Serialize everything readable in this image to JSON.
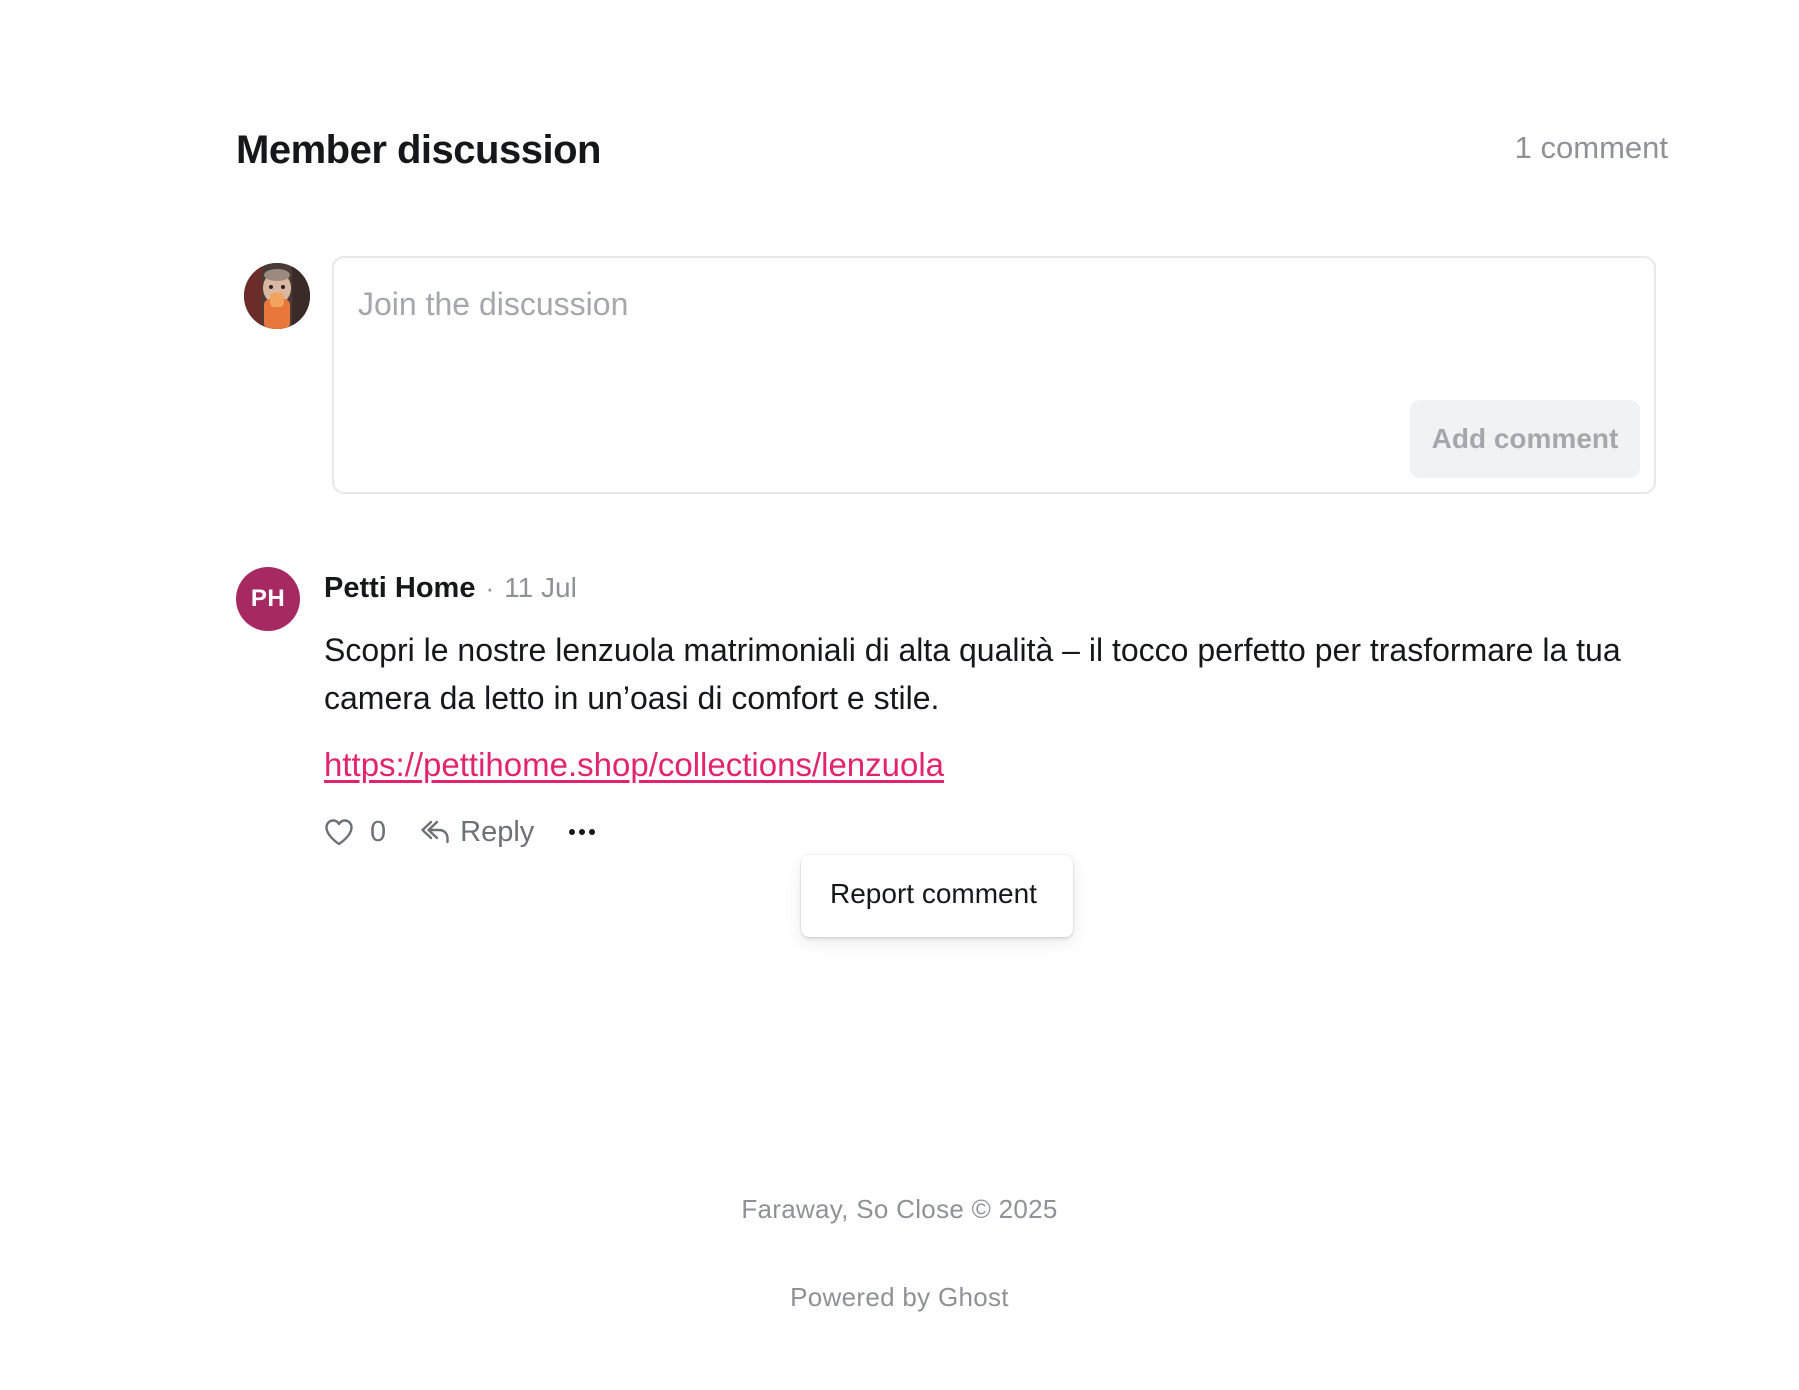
{
  "header": {
    "title": "Member discussion",
    "count": "1 comment"
  },
  "composer": {
    "placeholder": "Join the discussion",
    "submit_label": "Add comment",
    "avatar_icon": "user-photo-avatar"
  },
  "comments": [
    {
      "initials": "PH",
      "avatar_color": "#a62a61",
      "author": "Petti Home",
      "separator": "·",
      "date": "11 Jul",
      "body": "Scopri le nostre lenzuola matrimoniali di alta qualità – il tocco perfetto per trasformare la tua camera da letto in un’oasi di comfort e stile.",
      "link": "https://pettihome.shop/collections/lenzuola",
      "likes": "0",
      "reply_label": "Reply",
      "menu": {
        "items": [
          "Report comment"
        ]
      }
    }
  ],
  "footer": {
    "copyright": "Faraway, So Close © 2025",
    "powered_by": "Powered by Ghost"
  },
  "colors": {
    "accent": "#e2246f",
    "muted_text": "#8e9297"
  }
}
